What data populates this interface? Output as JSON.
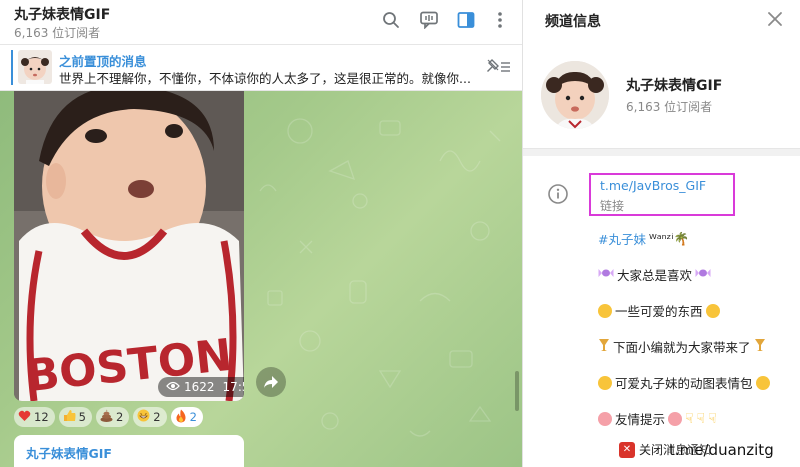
{
  "chat": {
    "title": "丸子妹表情GIF",
    "subscribers": "6,163 位订阅者"
  },
  "header_icons": [
    "search-icon",
    "comments-icon",
    "sidebar-toggle-icon",
    "more-vertical-icon"
  ],
  "pinned": {
    "title": "之前置顶的消息",
    "text": "世界上不理解你，不懂你，不体谅你的人太多了，这是很正常的。就像你..."
  },
  "message": {
    "views": "1622",
    "time": "17:58",
    "reactions": [
      {
        "emoji": "heart",
        "count": "12"
      },
      {
        "emoji": "thumbs-up",
        "count": "5"
      },
      {
        "emoji": "poop",
        "count": "2"
      },
      {
        "emoji": "grin",
        "count": "2"
      },
      {
        "emoji": "fire",
        "count": "2"
      }
    ]
  },
  "next_message": {
    "sender": "丸子妹表情GIF"
  },
  "panel": {
    "title": "频道信息",
    "channel_name": "丸子妹表情GIF",
    "subscribers": "6,163 位订阅者",
    "link": "t.me/JavBros_GIF",
    "link_label": "链接",
    "description": [
      {
        "tag": "#丸子妹",
        "text": "ᵂᵃⁿᶻⁱ🌴"
      },
      {
        "text": "大家总是喜欢"
      },
      {
        "text": "一些可爱的东西"
      },
      {
        "text": "下面小编就为大家带来了"
      },
      {
        "text": "可爱丸子妹的动图表情包"
      },
      {
        "text": "友情提示"
      }
    ]
  },
  "toast": {
    "text": "关闭消息通知"
  },
  "watermark": "t.me/duanzitg",
  "colors": {
    "accent": "#3a8fd9",
    "highlight_box": "#d93ad9",
    "chat_background": "#a4c98a"
  }
}
